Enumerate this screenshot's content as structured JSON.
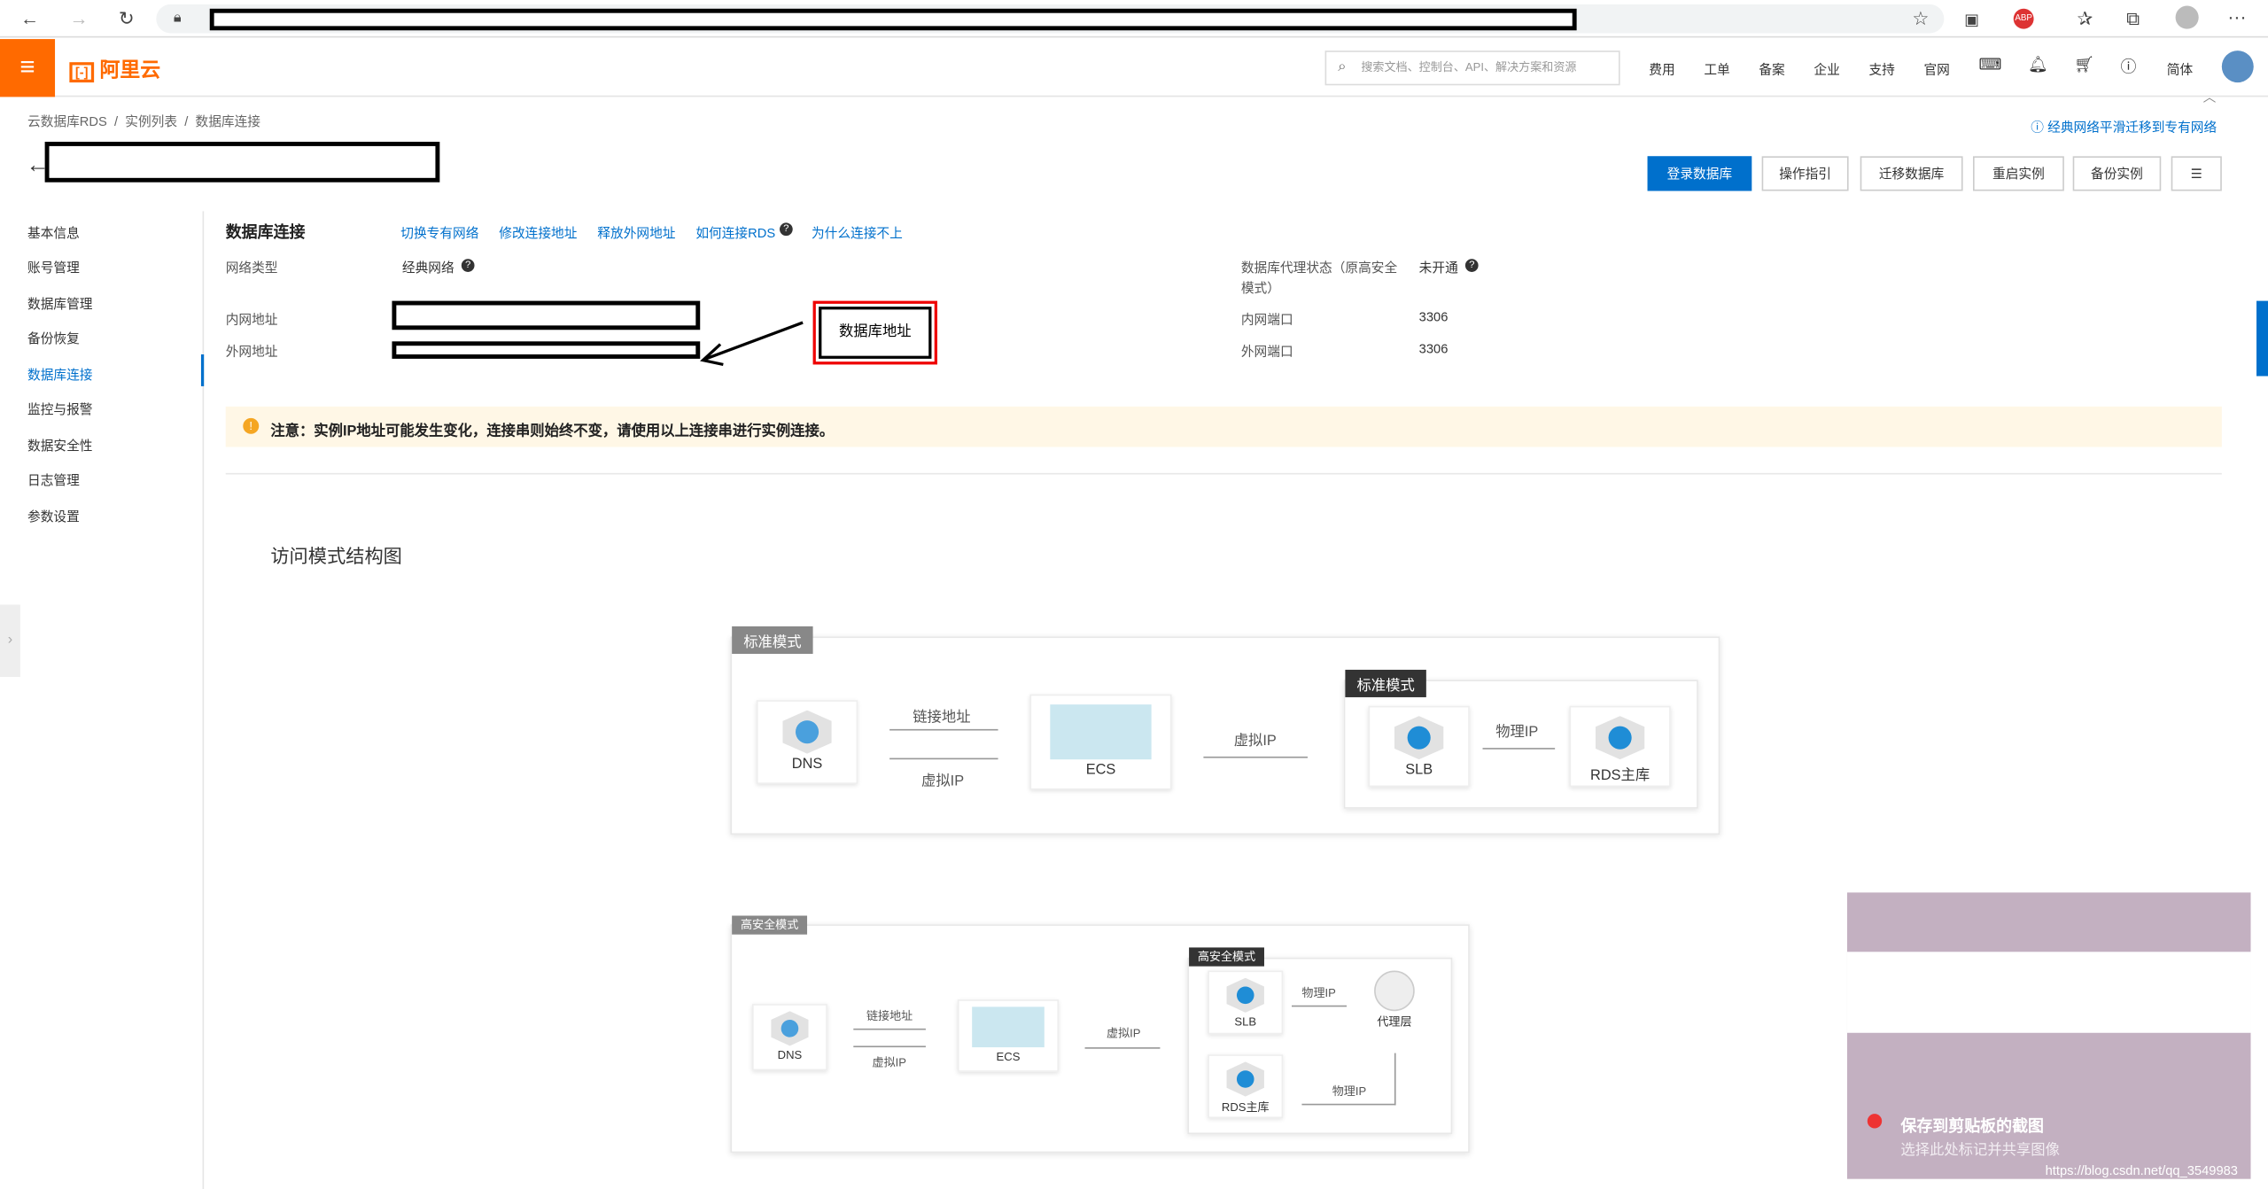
{
  "browser": {
    "icons": [
      "back-icon",
      "forward-icon",
      "refresh-icon",
      "lock-icon",
      "star-icon",
      "extension-icon",
      "abp-icon",
      "favorites-icon",
      "collections-icon",
      "profile-icon",
      "more-icon"
    ],
    "abp": "ABP",
    "more": "···"
  },
  "topbar": {
    "logo": "阿里云",
    "search_placeholder": "搜索文档、控制台、API、解决方案和资源",
    "nav": [
      "费用",
      "工单",
      "备案",
      "企业",
      "支持",
      "官网"
    ],
    "lang": "简体"
  },
  "breadcrumb": [
    "云数据库RDS",
    "实例列表",
    "数据库连接"
  ],
  "help_link": "经典网络平滑迁移到专有网络",
  "actions": [
    "登录数据库",
    "操作指引",
    "迁移数据库",
    "重启实例",
    "备份实例"
  ],
  "sidebar": [
    "基本信息",
    "账号管理",
    "数据库管理",
    "备份恢复",
    "数据库连接",
    "监控与报警",
    "数据安全性",
    "日志管理",
    "参数设置"
  ],
  "section": {
    "title": "数据库连接",
    "links": [
      "切换专有网络",
      "修改连接地址",
      "释放外网地址",
      "如何连接RDS",
      "为什么连接不上"
    ]
  },
  "fields": {
    "network_type_label": "网络类型",
    "network_type": "经典网络",
    "inner_label": "内网地址",
    "outer_label": "外网地址",
    "proxy_label": "数据库代理状态（原高安全模式）",
    "proxy_value": "未开通",
    "inner_port_label": "内网端口",
    "inner_port": "3306",
    "outer_port_label": "外网端口",
    "outer_port": "3306"
  },
  "annotation": "数据库地址",
  "notice": "注意：实例IP地址可能发生变化，连接串则始终不变，请使用以上连接串进行实例连接。",
  "diagram_title": "访问模式结构图",
  "standard": {
    "tag": "标准模式",
    "inner_tag": "标准模式",
    "dns": "DNS",
    "link_addr": "链接地址",
    "vip": "虚拟IP",
    "ecs": "ECS",
    "vip2": "虚拟IP",
    "slb": "SLB",
    "physical_ip": "物理IP",
    "rds": "RDS主库"
  },
  "secure": {
    "tag": "高安全模式",
    "inner_tag": "高安全模式",
    "dns": "DNS",
    "link_addr": "链接地址",
    "vip": "虚拟IP",
    "ecs": "ECS",
    "vip2": "虚拟IP",
    "slb": "SLB",
    "physical_ip": "物理IP",
    "proxy": "代理层",
    "rds": "RDS主库",
    "physical_ip2": "物理IP"
  },
  "toast": {
    "title": "保存到剪贴板的截图",
    "subtitle": "选择此处标记并共享图像"
  },
  "watermark": "https://blog.csdn.net/qq_3549983"
}
